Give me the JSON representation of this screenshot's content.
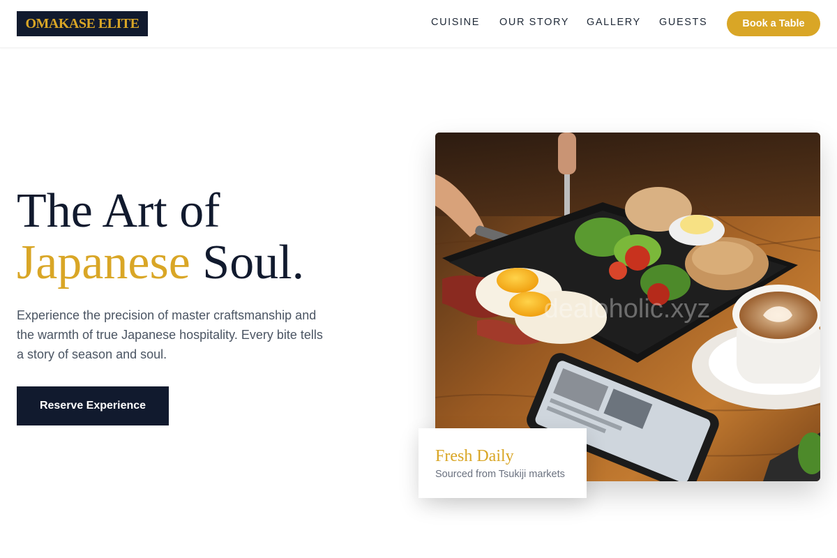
{
  "brand": {
    "name": "OMAKASE ELITE"
  },
  "nav": {
    "items": [
      "CUISINE",
      "OUR STORY",
      "GALLERY",
      "GUESTS"
    ],
    "cta": "Book a Table"
  },
  "hero": {
    "title_line1": "The Art of",
    "title_accent": "Japanese",
    "title_rest": " Soul.",
    "description": "Experience the precision of master craftsmanship and the warmth of true Japanese hospitality. Every bite tells a story of season and soul.",
    "cta": "Reserve Experience"
  },
  "feature_card": {
    "title": "Fresh Daily",
    "subtitle": "Sourced from Tsukiji markets"
  },
  "photo": {
    "watermark": "dealoholic.xyz"
  },
  "colors": {
    "accent": "#d9a626",
    "navy": "#111a2e",
    "body_text": "#4b5563"
  }
}
